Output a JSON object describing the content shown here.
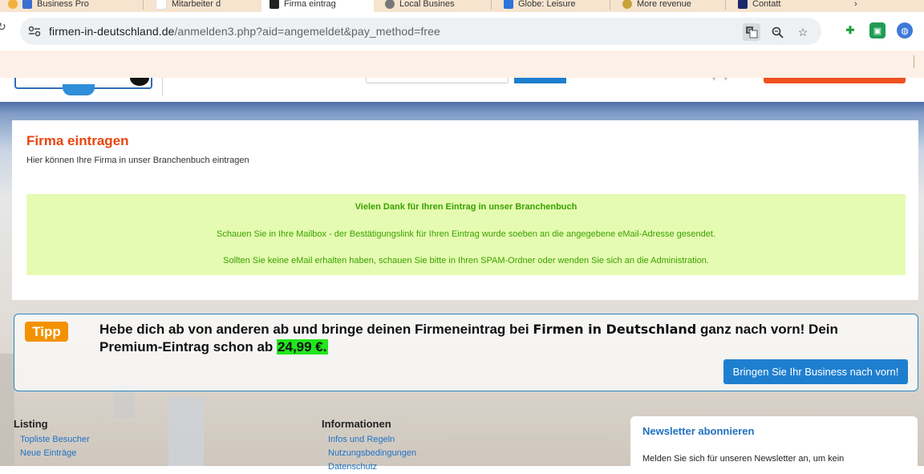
{
  "browser": {
    "tabs": [
      {
        "label": "Business Pro",
        "favicon_color": "#3a6fd1",
        "active": false
      },
      {
        "label": "Mitarbeiter d",
        "favicon_color": "#ffffff",
        "active": false
      },
      {
        "label": "Firma eintrag",
        "favicon_color": "#222222",
        "active": true
      },
      {
        "label": "Local Busines",
        "favicon_color": "#777777",
        "active": false
      },
      {
        "label": "Globe: Leisure",
        "favicon_color": "#2e74d8",
        "active": false
      },
      {
        "label": "More revenue",
        "favicon_color": "#c9a23b",
        "active": false
      },
      {
        "label": "Contatt",
        "favicon_color": "#1a2a6a",
        "active": false
      }
    ],
    "url_domain": "firmen-in-deutschland.de",
    "url_path": "/anmelden3.php?aid=angemeldet&pay_method=free"
  },
  "page": {
    "title": "Firma eintragen",
    "subtitle": "Hier können Ihre Firma in unser Branchenbuch eintragen",
    "success": {
      "title": "Vielen Dank für Ihren Eintrag in unser Branchenbuch",
      "line1": "Schauen Sie in Ihre Mailbox - der Bestätigungslink für Ihren Eintrag wurde soeben an die angegebene eMail-Adresse gesendet.",
      "line2": "Sollten Sie keine eMail erhalten haben, schauen Sie bitte in Ihren SPAM-Ordner oder wenden Sie sich an die Administration."
    }
  },
  "tipp": {
    "badge": "Tipp",
    "text_before": "Hebe dich ab von anderen ab und bringe deinen Firmeneintrag bei ",
    "brand": "Firmen in Deutschland",
    "text_after": " ganz nach vorn! Dein Premium-Eintrag schon ab ",
    "price": "24,99 €.",
    "button": "Bringen Sie Ihr Business nach vorn!"
  },
  "footer": {
    "listing": {
      "heading": "Listing",
      "links": [
        "Topliste Besucher",
        "Neue Einträge"
      ]
    },
    "info": {
      "heading": "Informationen",
      "links": [
        "Infos und Regeln",
        "Nutzungsbedingungen",
        "Datenschutz"
      ]
    },
    "newsletter": {
      "heading": "Newsletter abonnieren",
      "text": "Melden Sie sich für unseren Newsletter an, um kein"
    }
  },
  "colors": {
    "accent_orange": "#e8450f",
    "link_blue": "#2173c7",
    "success_bg": "#e5fbb1",
    "success_text": "#3aa100",
    "price_highlight": "#22e51c",
    "tipp_badge": "#f39200"
  }
}
